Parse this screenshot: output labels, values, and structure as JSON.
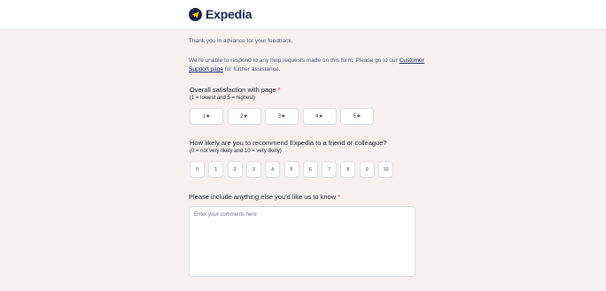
{
  "header": {
    "brand": "Expedia",
    "logo_icon": "expedia-plane-icon"
  },
  "intro": {
    "thanks": "Thank you in advance for your feedback.",
    "notice_prefix": "We’re unable to respond to any help requests made on this form. Please go to our",
    "support_link": "Customer Support page",
    "notice_suffix": "for further assistance."
  },
  "satisfaction": {
    "label": "Overall satisfaction with page",
    "required_mark": "*",
    "hint": "(1 = lowest and 5 = highest)",
    "options": [
      "1★",
      "2★",
      "3★",
      "4★",
      "5★"
    ]
  },
  "recommend": {
    "label": "How likely are you to recommend Expedia to a friend or colleague?",
    "hint": "(0 = not very likely and 10 = very likely)",
    "options": [
      "0",
      "1",
      "2",
      "3",
      "4",
      "5",
      "6",
      "7",
      "8",
      "9",
      "10"
    ]
  },
  "comments": {
    "label": "Please include anything else you'd like us to know",
    "required_mark": "*",
    "placeholder": "Enter your comments here",
    "value": ""
  },
  "colors": {
    "page_bg": "#f6f1ee",
    "brand_navy": "#1a2142",
    "required_red": "#c9293a"
  }
}
